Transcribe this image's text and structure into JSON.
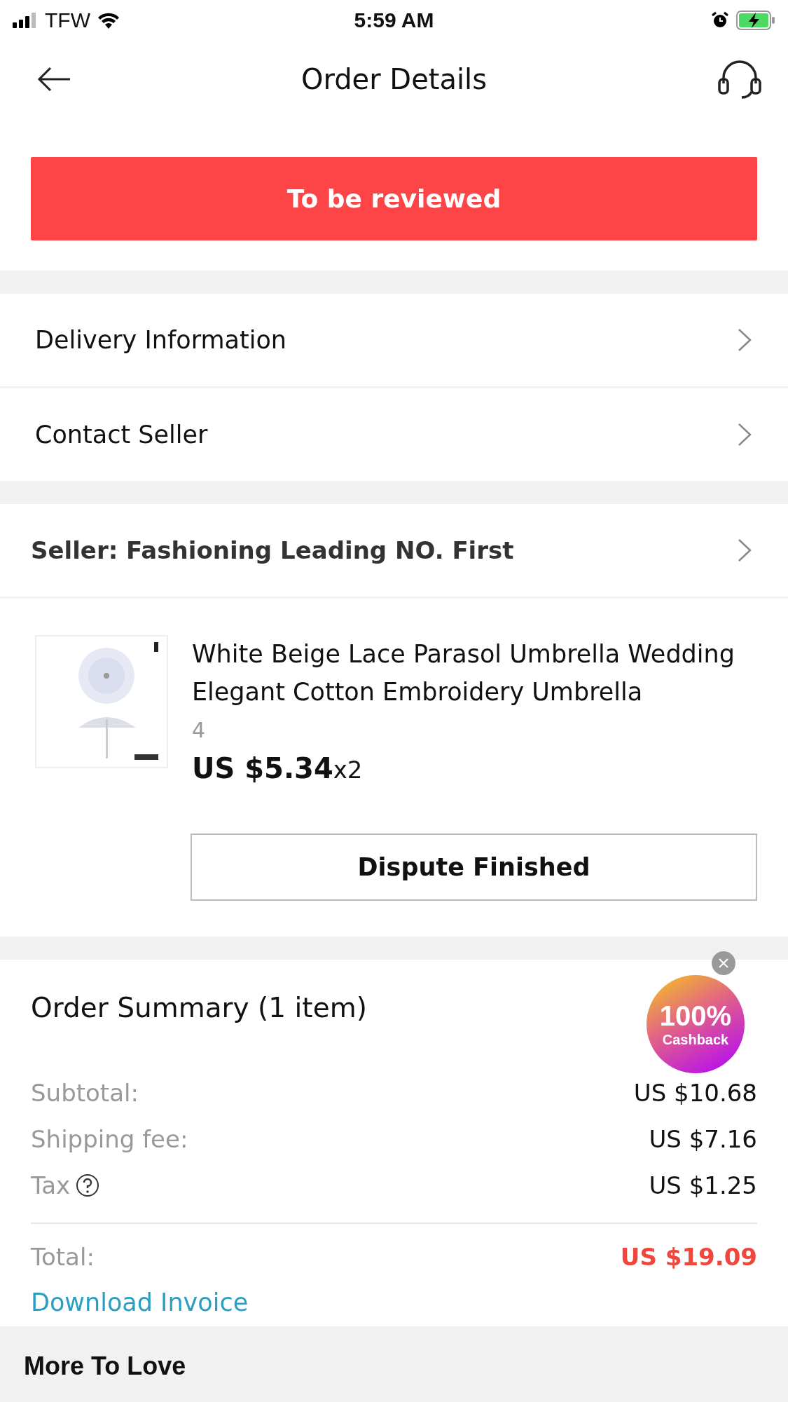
{
  "status_bar": {
    "carrier": "TFW",
    "time": "5:59 AM"
  },
  "header": {
    "title": "Order Details"
  },
  "status_button": "To be reviewed",
  "menu_rows": [
    {
      "label": "Delivery Information"
    },
    {
      "label": "Contact Seller"
    }
  ],
  "seller": {
    "label": "Seller: Fashioning Leading NO. First"
  },
  "product": {
    "title": "White Beige Lace Parasol Umbrella Wedding Elegant Cotton Embroidery Umbrella",
    "variant": "4",
    "price": "US $5.34",
    "quantity": "x2",
    "action": "Dispute Finished"
  },
  "summary": {
    "title": "Order Summary (1 item)",
    "rows": [
      {
        "label": "Subtotal:",
        "value": "US $10.68"
      },
      {
        "label": "Shipping fee:",
        "value": "US $7.16"
      },
      {
        "label": "Tax",
        "value": "US $1.25",
        "help": true
      }
    ],
    "total_label": "Total:",
    "total_value": "US $19.09",
    "invoice_link": "Download Invoice"
  },
  "cashback_badge": {
    "percent": "100%",
    "label": "Cashback"
  },
  "more_section": {
    "title": "More To Love"
  }
}
